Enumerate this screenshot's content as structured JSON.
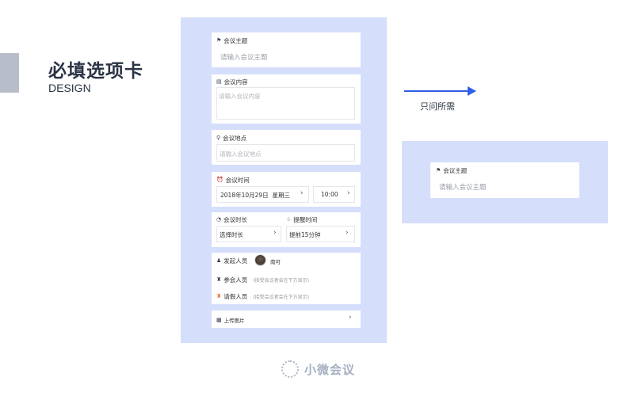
{
  "header": {
    "title": "必填选项卡",
    "subtitle": "DESIGN"
  },
  "form": {
    "topic": {
      "label": "会议主题",
      "icon": "flag-icon",
      "placeholder": "请输入会议主题"
    },
    "content": {
      "label": "会议内容",
      "icon": "document-icon",
      "placeholder": "请输入会议内容"
    },
    "location": {
      "label": "会议地点",
      "icon": "location-pin-icon",
      "placeholder": "请输入会议地点"
    },
    "time": {
      "label": "会议时间",
      "icon": "alarm-clock-icon",
      "date": "2018年10月29日",
      "weekday": "星期三",
      "clock": "10:00"
    },
    "duration": {
      "label": "会议时长",
      "icon": "clock-icon",
      "value": "选择时长"
    },
    "reminder": {
      "label": "提醒时间",
      "icon": "bell-icon",
      "value": "提前15分钟"
    },
    "people": {
      "initiator": {
        "label": "发起人员",
        "icon": "person-icon",
        "name": "南可"
      },
      "attendees": {
        "label": "参会人员",
        "icon": "group-icon",
        "hint": "(接受会议者会在下方显示)"
      },
      "leave": {
        "label": "请假人员",
        "icon": "group-orange-icon",
        "hint": "(接受会议者会在下方显示)",
        "icon_color": "#e8743b"
      }
    },
    "upload": {
      "label": "上传图片",
      "icon": "image-icon"
    }
  },
  "annotation": {
    "text": "只问所需",
    "arrow_color": "#2e5fe8"
  },
  "zoom_card": {
    "label": "会议主题",
    "placeholder": "请输入会议主题"
  },
  "logo": {
    "text": "小微会议"
  },
  "colors": {
    "panel_bg": "#d5defb",
    "heading": "#2b3445",
    "logo": "#a4afc2"
  }
}
